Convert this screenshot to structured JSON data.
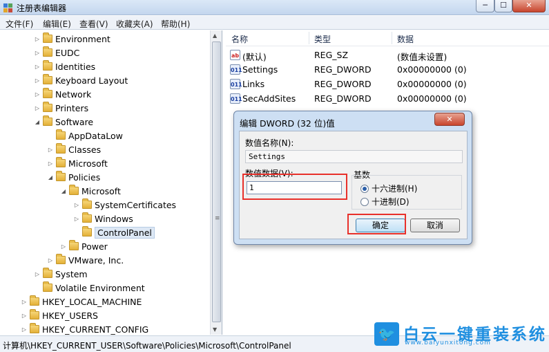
{
  "window": {
    "title": "注册表编辑器",
    "min_glyph": "─",
    "max_glyph": "☐",
    "close_glyph": "✕"
  },
  "menu": [
    "文件(F)",
    "编辑(E)",
    "查看(V)",
    "收藏夹(A)",
    "帮助(H)"
  ],
  "tree": [
    {
      "label": "Environment",
      "arrow": "▷"
    },
    {
      "label": "EUDC",
      "arrow": "▷"
    },
    {
      "label": "Identities",
      "arrow": "▷"
    },
    {
      "label": "Keyboard Layout",
      "arrow": "▷"
    },
    {
      "label": "Network",
      "arrow": "▷"
    },
    {
      "label": "Printers",
      "arrow": "▷"
    },
    {
      "label": "Software",
      "arrow": "◢"
    },
    {
      "label": "AppDataLow",
      "arrow": ""
    },
    {
      "label": "Classes",
      "arrow": "▷"
    },
    {
      "label": "Microsoft",
      "arrow": "▷"
    },
    {
      "label": "Policies",
      "arrow": "◢"
    },
    {
      "label": "Microsoft",
      "arrow": "◢"
    },
    {
      "label": "SystemCertificates",
      "arrow": "▷"
    },
    {
      "label": "Windows",
      "arrow": "▷"
    },
    {
      "label": "ControlPanel",
      "arrow": "",
      "selected": true
    },
    {
      "label": "Power",
      "arrow": "▷"
    },
    {
      "label": "VMware, Inc.",
      "arrow": "▷"
    },
    {
      "label": "System",
      "arrow": "▷"
    },
    {
      "label": "Volatile Environment",
      "arrow": ""
    },
    {
      "label": "HKEY_LOCAL_MACHINE",
      "arrow": "▷"
    },
    {
      "label": "HKEY_USERS",
      "arrow": "▷"
    },
    {
      "label": "HKEY_CURRENT_CONFIG",
      "arrow": "▷"
    }
  ],
  "list": {
    "headers": {
      "name": "名称",
      "type": "类型",
      "data": "数据"
    },
    "rows": [
      {
        "icon": "ab",
        "icon_name": "string-value-icon",
        "name": "(默认)",
        "type": "REG_SZ",
        "data": "(数值未设置)"
      },
      {
        "icon": "011",
        "icon_name": "dword-value-icon",
        "name": "Settings",
        "type": "REG_DWORD",
        "data": "0x00000000 (0)"
      },
      {
        "icon": "011",
        "icon_name": "dword-value-icon",
        "name": "Links",
        "type": "REG_DWORD",
        "data": "0x00000000 (0)"
      },
      {
        "icon": "011",
        "icon_name": "dword-value-icon",
        "name": "SecAddSites",
        "type": "REG_DWORD",
        "data": "0x00000000 (0)"
      }
    ]
  },
  "dialog": {
    "title": "编辑 DWORD (32 位)值",
    "close_glyph": "✕",
    "name_label": "数值名称(N):",
    "name_value": "Settings",
    "data_label": "数值数据(V):",
    "data_value": "1",
    "base_label": "基数",
    "hex_label": "十六进制(H)",
    "dec_label": "十进制(D)",
    "ok": "确定",
    "cancel": "取消"
  },
  "status": "计算机\\HKEY_CURRENT_USER\\Software\\Policies\\Microsoft\\ControlPanel",
  "watermark": {
    "title": "白云一键重装系统",
    "url": "www.baiyunxitong.com",
    "badge_glyph": "🐦"
  },
  "colors": {
    "highlight": "#e8302a",
    "watermark": "#1f8fe0"
  },
  "scrollbar": {
    "up_glyph": "▲",
    "down_glyph": "▼",
    "grip_glyph": "≡"
  }
}
